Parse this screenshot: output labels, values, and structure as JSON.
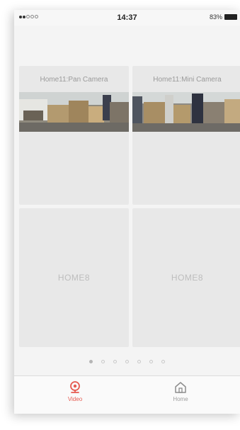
{
  "status": {
    "time": "14:37",
    "battery": "83%"
  },
  "cameras": [
    {
      "title": "Home11:Pan Camera"
    },
    {
      "title": "Home11:Mini Camera"
    }
  ],
  "devices": [
    {
      "name": "HOME8"
    },
    {
      "name": "HOME8"
    }
  ],
  "pager": {
    "count": 7,
    "active": 0
  },
  "tabs": [
    {
      "label": "Video",
      "icon": "camera-icon",
      "active": true
    },
    {
      "label": "Home",
      "icon": "home-icon",
      "active": false
    }
  ],
  "colors": {
    "accent": "#e55a50",
    "tile": "#e8e8e8",
    "inactive": "#9d9d9d"
  }
}
